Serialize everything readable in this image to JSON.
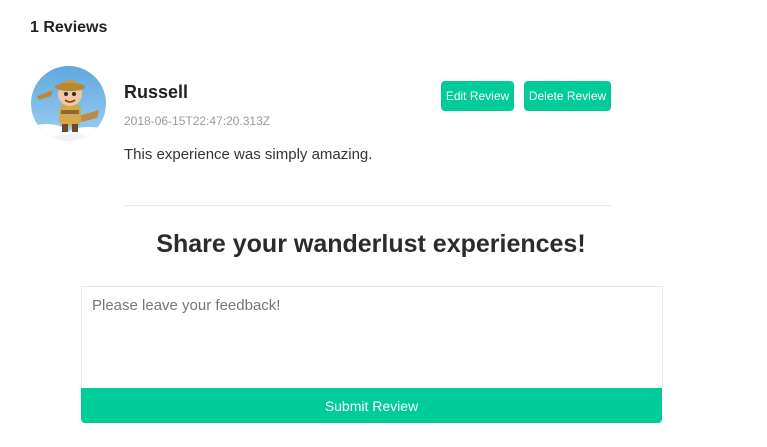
{
  "reviews": {
    "count_label": "1 Reviews"
  },
  "review": {
    "author": "Russell",
    "timestamp": "2018-06-15T22:47:20.313Z",
    "text": "This experience was simply amazing.",
    "avatar_icon": "avatar-image",
    "edit_label": "Edit Review",
    "delete_label": "Delete Review"
  },
  "form": {
    "heading": "Share your wanderlust experiences!",
    "placeholder": "Please leave your feedback!",
    "value": "",
    "submit_label": "Submit Review"
  },
  "colors": {
    "accent": "#00cc9a",
    "divider": "#e6e6e6"
  }
}
